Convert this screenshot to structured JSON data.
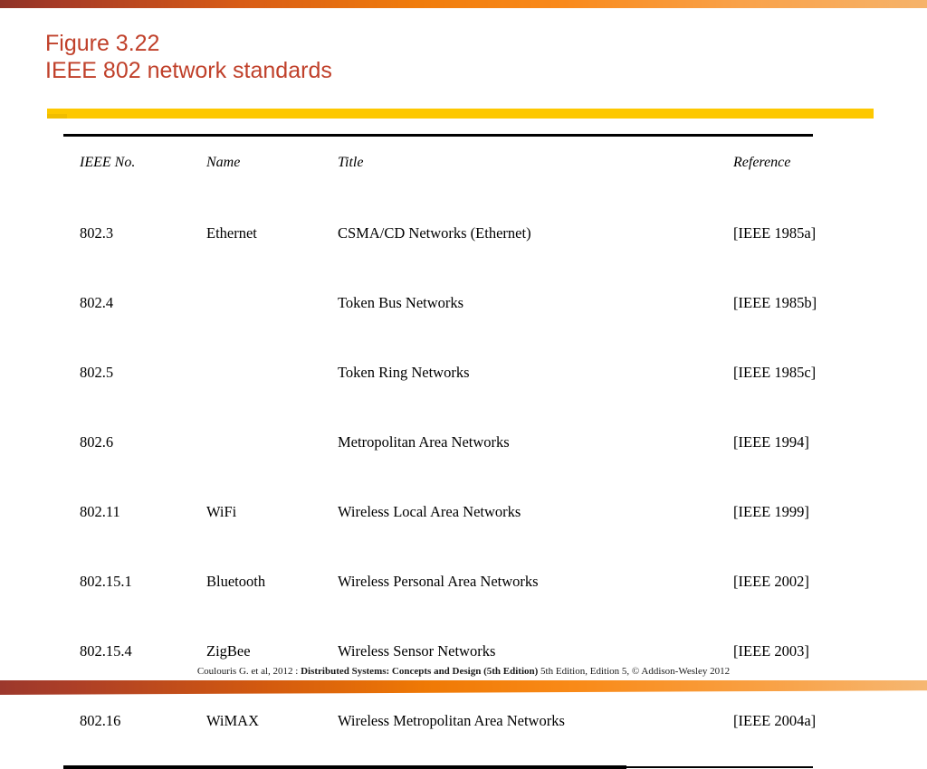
{
  "slide": {
    "title_line1": "Figure 3.22",
    "title_line2": "IEEE 802 network standards",
    "title_color": "#c0402a",
    "accent_rule_color": "#fdc800",
    "top_bar_colors": [
      "#8e3327",
      "#f07c0c",
      "#f6b36a"
    ],
    "bottom_bar_colors": [
      "#9c382c",
      "#ef7905",
      "#f6b772"
    ]
  },
  "table": {
    "headers": {
      "ieee_no": "IEEE No.",
      "name": "Name",
      "title": "Title",
      "reference": "Reference"
    },
    "rows": [
      {
        "ieee_no": "802.3",
        "name": "Ethernet",
        "title": "CSMA/CD Networks (Ethernet)",
        "reference": "[IEEE 1985a]"
      },
      {
        "ieee_no": "802.4",
        "name": "",
        "title": "Token Bus Networks",
        "reference": "[IEEE 1985b]"
      },
      {
        "ieee_no": "802.5",
        "name": "",
        "title": "Token Ring Networks",
        "reference": "[IEEE 1985c]"
      },
      {
        "ieee_no": "802.6",
        "name": "",
        "title": "Metropolitan Area Networks",
        "reference": "[IEEE 1994]"
      },
      {
        "ieee_no": "802.11",
        "name": "WiFi",
        "title": "Wireless Local Area Networks",
        "reference": "[IEEE 1999]"
      },
      {
        "ieee_no": "802.15.1",
        "name": "Bluetooth",
        "title": "Wireless Personal Area Networks",
        "reference": "[IEEE 2002]"
      },
      {
        "ieee_no": "802.15.4",
        "name": "ZigBee",
        "title": "Wireless Sensor Networks",
        "reference": "[IEEE 2003]"
      },
      {
        "ieee_no": "802.16",
        "name": "WiMAX",
        "title": "Wireless Metropolitan Area Networks",
        "reference": "[IEEE 2004a]"
      }
    ]
  },
  "footer": {
    "prefix": "Coulouris G. et al, 2012 : ",
    "book_bold": "Distributed Systems: Concepts and Design (5th Edition)",
    "suffix": " 5th Edition, Edition 5, © Addison-Wesley 2012"
  }
}
